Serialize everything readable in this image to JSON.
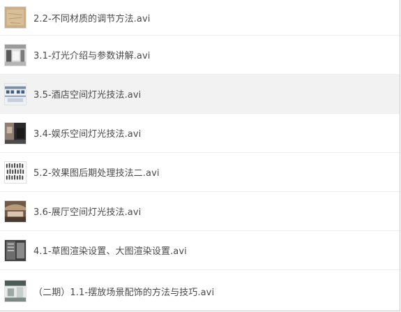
{
  "files": [
    {
      "name": "2.2-不同材质的调节方法.avi",
      "thumbnail": "paper-texture-thumbnail",
      "selected": false
    },
    {
      "name": "3.1-灯光介绍与参数讲解.avi",
      "thumbnail": "interior-room-thumbnail",
      "selected": false
    },
    {
      "name": "3.5-酒店空间灯光技法.avi",
      "thumbnail": "hotel-lobby-thumbnail",
      "selected": true
    },
    {
      "name": "3.4-娱乐空间灯光技法.avi",
      "thumbnail": "entertainment-space-thumbnail",
      "selected": false
    },
    {
      "name": "5.2-效果图后期处理技法二.avi",
      "thumbnail": "figure-cutouts-thumbnail",
      "selected": false
    },
    {
      "name": "3.6-展厅空间灯光技法.avi",
      "thumbnail": "exhibition-hall-thumbnail",
      "selected": false
    },
    {
      "name": "4.1-草图渲染设置、大图渲染设置.avi",
      "thumbnail": "render-settings-thumbnail",
      "selected": false
    },
    {
      "name": "（二期）1.1-摆放场景配饰的方法与技巧.avi",
      "thumbnail": "scene-decor-thumbnail",
      "selected": false
    }
  ],
  "colors": {
    "text": "#4a4a4a",
    "selected_row": "#f2f2f2",
    "divider": "#efefef"
  }
}
